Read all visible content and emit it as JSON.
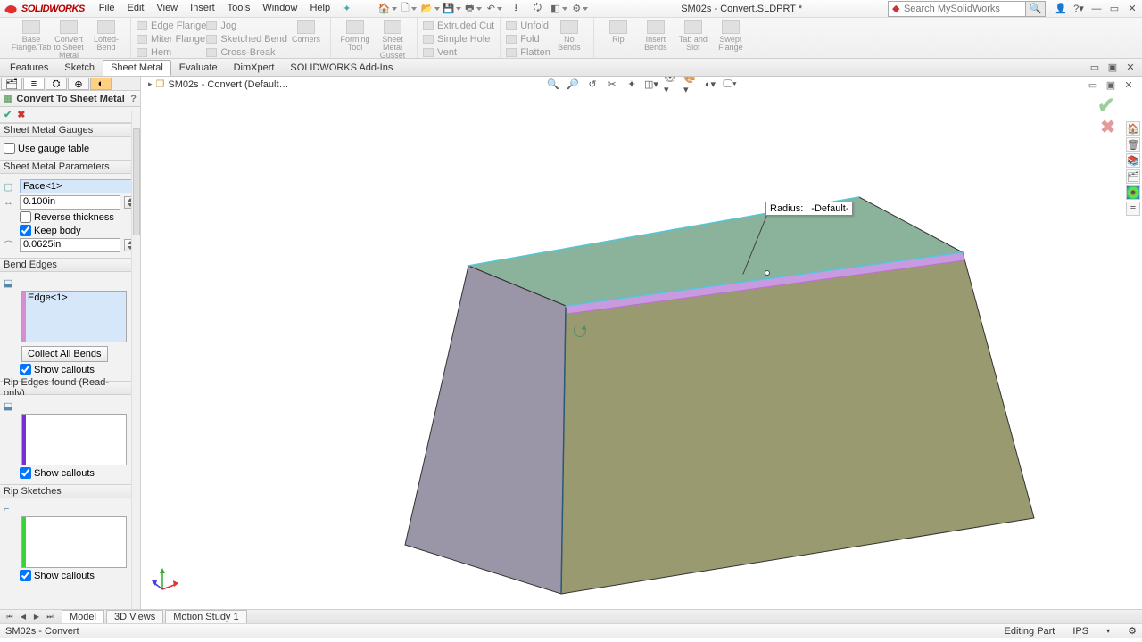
{
  "app": {
    "logo_text": "SOLIDWORKS",
    "doc_title": "SM02s - Convert.SLDPRT *",
    "search_placeholder": "Search MySolidWorks"
  },
  "menubar": [
    "File",
    "Edit",
    "View",
    "Insert",
    "Tools",
    "Window",
    "Help"
  ],
  "ribbon": {
    "groups": [
      {
        "big": [
          {
            "label": "Base\nFlange/Tab"
          },
          {
            "label": "Convert\nto Sheet\nMetal"
          },
          {
            "label": "Lofted-Bend"
          }
        ]
      },
      {
        "small": [
          "Edge Flange",
          "Miter Flange",
          "Hem",
          "Jog",
          "Sketched Bend",
          "Cross-Break"
        ],
        "big": [
          {
            "label": "Corners"
          }
        ]
      },
      {
        "big": [
          {
            "label": "Forming\nTool"
          },
          {
            "label": "Sheet\nMetal\nGusset"
          }
        ]
      },
      {
        "small": [
          "Extruded Cut",
          "Simple Hole",
          "Vent"
        ]
      },
      {
        "small": [
          "Unfold",
          "Fold",
          "Flatten"
        ],
        "big": [
          {
            "label": "No\nBends"
          }
        ]
      },
      {
        "big": [
          {
            "label": "Rip"
          },
          {
            "label": "Insert\nBends"
          },
          {
            "label": "Tab and\nSlot"
          },
          {
            "label": "Swept\nFlange"
          }
        ]
      }
    ]
  },
  "tabs": [
    "Features",
    "Sketch",
    "Sheet Metal",
    "Evaluate",
    "DimXpert",
    "SOLIDWORKS Add-Ins"
  ],
  "active_tab": "Sheet Metal",
  "feature": {
    "title": "Convert To Sheet Metal",
    "sections": {
      "gauges": {
        "title": "Sheet Metal Gauges",
        "use_gauge": "Use gauge table",
        "use_gauge_checked": false
      },
      "params": {
        "title": "Sheet Metal Parameters",
        "face": "Face<1>",
        "thickness": "0.100in",
        "reverse": "Reverse thickness",
        "reverse_checked": false,
        "keep": "Keep body",
        "keep_checked": true,
        "radius": "0.0625in"
      },
      "bend": {
        "title": "Bend Edges",
        "edge": "Edge<1>",
        "collect": "Collect All Bends",
        "show": "Show callouts",
        "show_checked": true,
        "stripe": "#d58ed0"
      },
      "rip_found": {
        "title": "Rip Edges found (Read-only)",
        "show": "Show callouts",
        "show_checked": true,
        "stripe": "#7a2fd6"
      },
      "rip_sketch": {
        "title": "Rip Sketches",
        "show": "Show callouts",
        "show_checked": true,
        "stripe": "#3ad13a"
      }
    }
  },
  "flyout_tree": "SM02s - Convert  (Default…",
  "callout": {
    "label": "Radius:",
    "value": "-Default-"
  },
  "bottom_tabs": [
    "Model",
    "3D Views",
    "Motion Study 1"
  ],
  "active_bottom_tab": "Model",
  "status": {
    "left": "SM02s - Convert",
    "mode": "Editing Part",
    "units": "IPS"
  }
}
